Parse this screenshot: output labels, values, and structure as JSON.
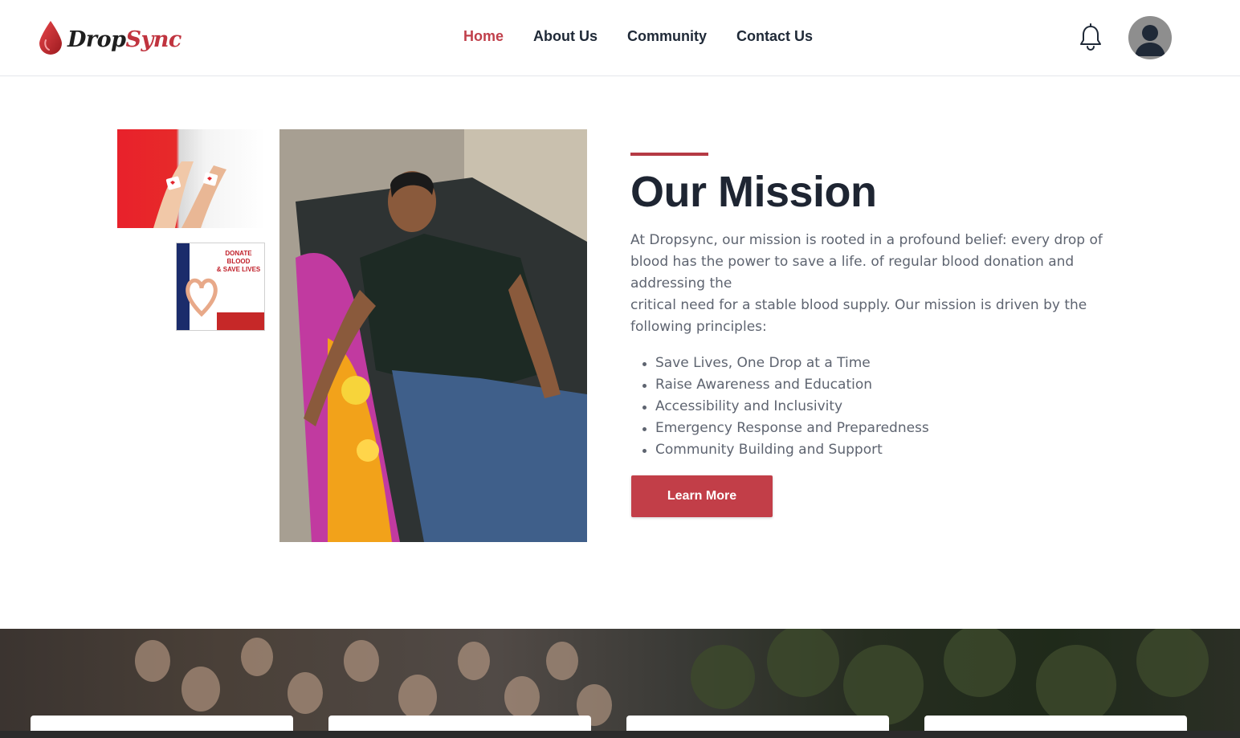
{
  "brand": {
    "name_part1": "Drop",
    "name_part2": "Sync",
    "accent_color": "#c0343f"
  },
  "nav": {
    "items": [
      {
        "label": "Home",
        "active": true
      },
      {
        "label": "About Us",
        "active": false
      },
      {
        "label": "Community",
        "active": false
      },
      {
        "label": "Contact Us",
        "active": false
      }
    ]
  },
  "header_icons": {
    "notifications": "bell-icon",
    "profile": "user-avatar-icon"
  },
  "images": {
    "top_left": "arms-with-bandages",
    "poster": "donate-blood-poster",
    "main": "man-donating-blood-on-bed"
  },
  "poster": {
    "title_line1": "DONATE BLOOD",
    "title_line2": "& SAVE LIVES"
  },
  "mission": {
    "title": "Our Mission",
    "paragraph_1": "At Dropsync, our mission is rooted in a profound belief: every drop of blood has the power to save a life. of regular blood donation and addressing the",
    "paragraph_2": "critical need for a stable blood supply. Our mission is driven by the following principles:",
    "principles": [
      "Save Lives, One Drop at a Time",
      "Raise Awareness and Education",
      "Accessibility and Inclusivity",
      "Emergency Response and Preparedness",
      "Community Building and Support"
    ],
    "button_label": "Learn More"
  },
  "colors": {
    "primary_red": "#c23e48",
    "heading": "#1e2532",
    "body_text": "#5e6470"
  }
}
